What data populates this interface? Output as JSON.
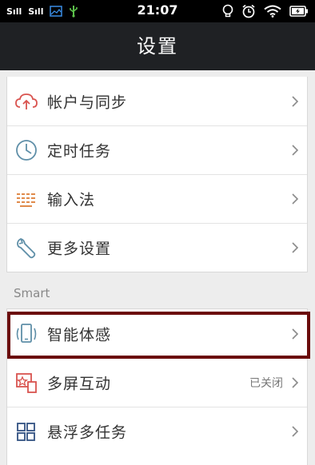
{
  "status_bar": {
    "time": "21:07",
    "signal_1": "Sıll",
    "signal_2": "Sıll"
  },
  "header": {
    "title": "设置"
  },
  "groups": [
    {
      "items": [
        {
          "label": "帐户与同步",
          "icon": "cloud-sync-icon"
        },
        {
          "label": "定时任务",
          "icon": "clock-icon"
        },
        {
          "label": "输入法",
          "icon": "keyboard-icon"
        },
        {
          "label": "更多设置",
          "icon": "wrench-icon"
        }
      ]
    },
    {
      "title": "Smart",
      "items": [
        {
          "label": "智能体感",
          "icon": "phone-motion-icon"
        },
        {
          "label": "多屏互动",
          "icon": "multi-screen-icon",
          "value": "已关闭"
        },
        {
          "label": "悬浮多任务",
          "icon": "floating-window-icon"
        }
      ]
    }
  ],
  "colors": {
    "header_bg": "#1f2124",
    "icon_red": "#d9534f",
    "icon_blue": "#5f8fa8",
    "icon_orange": "#e08a4a",
    "highlight": "#6b0b0b"
  }
}
